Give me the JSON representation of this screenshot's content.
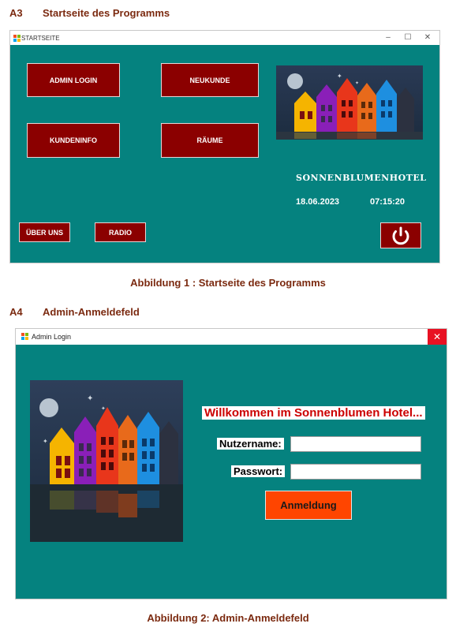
{
  "section_a3": {
    "number": "A3",
    "title": "Startseite des Programms"
  },
  "window1": {
    "title": "STARTSEITE",
    "controls": {
      "minimize": "–",
      "maximize": "☐",
      "close": "✕"
    },
    "buttons": {
      "admin_login": "ADMIN LOGIN",
      "neukunde": "NEUKUNDE",
      "kundeninfo": "KUNDENINFO",
      "raeume": "RÄUME",
      "ueber_uns": "ÜBER UNS",
      "radio": "RADIO"
    },
    "hotel_name": "SONNENBLUMENHOTEL",
    "date": "18.06.2023",
    "time": "07:15:20",
    "colors": {
      "background": "#05827f",
      "button": "#8b0000"
    }
  },
  "caption1": "Abbildung 1 : Startseite des Programms",
  "section_a4": {
    "number": "A4",
    "title": "Admin-Anmeldefeld"
  },
  "window2": {
    "title": "Admin Login",
    "close": "✕",
    "welcome": "Willkommen im Sonnenblumen Hotel...",
    "username_label": "Nutzername:",
    "username_value": "",
    "password_label": "Passwort:",
    "password_value": "",
    "login_button": "Anmeldung",
    "colors": {
      "background": "#05827f",
      "login_button": "#ff4500"
    }
  },
  "caption2": "Abbildung 2: Admin-Anmeldefeld"
}
